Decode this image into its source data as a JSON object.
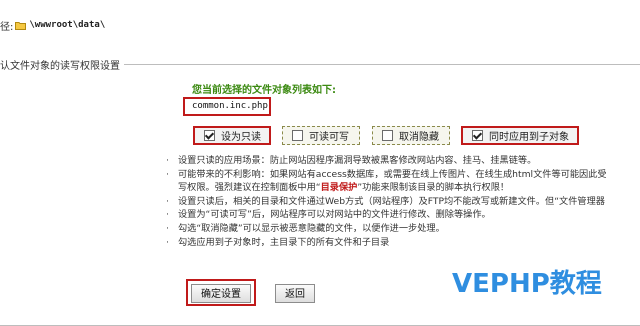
{
  "path_row": {
    "prefix": "径:",
    "path": "\\wwwroot\\data\\"
  },
  "section": {
    "legend": "认文件对象的读写权限设置",
    "heading": "您当前选择的文件对象列表如下:",
    "file_list": "common.inc.php"
  },
  "options": [
    {
      "label": "设为只读",
      "checked": true
    },
    {
      "label": "可读可写",
      "checked": false
    },
    {
      "label": "取消隐藏",
      "checked": false
    },
    {
      "label": "同时应用到子对象",
      "checked": true
    }
  ],
  "notes": {
    "n1": "设置只读的应用场景：防止网站因程序漏洞导致被黑客修改网站内容、挂马、挂黑链等。",
    "n2a": "可能带来的不利影响：如果网站有access数据库，或需要在线上传图片、在线生成html文件等可能因此受",
    "n2b_pre": "写权限。强烈建议在控制面板中用“",
    "n2b_red": "目录保护",
    "n2b_post": "”功能来限制该目录的脚本执行权限！",
    "n3": "设置只读后，相关的目录和文件通过Web方式（网站程序）及FTP均不能改写或新建文件。但“文件管理器",
    "n4": "设置为“可读可写”后，网站程序可以对网站中的文件进行修改、删除等操作。",
    "n5": "勾选“取消隐藏”可以显示被恶意隐藏的文件，以便作进一步处理。",
    "n6": "勾选应用到子对象时，主目录下的所有文件和子目录"
  },
  "buttons": {
    "confirm": "确定设置",
    "back": "返回"
  },
  "watermark": "VEPHP教程"
}
